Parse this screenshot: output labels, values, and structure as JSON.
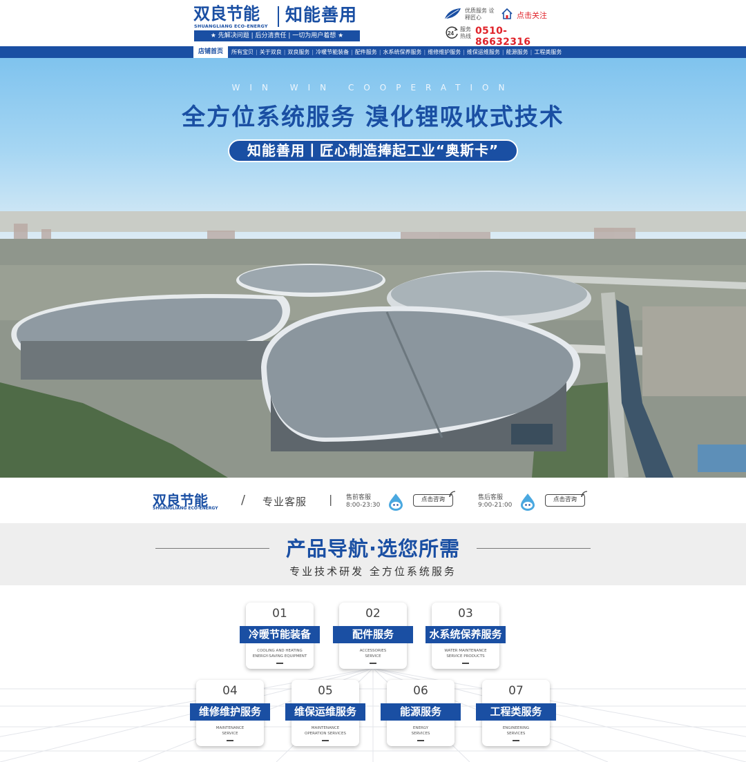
{
  "header": {
    "logo_cn": "双良节能",
    "logo_en": "SHUANGLIANG ECO-ENERGY",
    "logo_slogan": "知能善用",
    "logo_bar": "★ 先解决问题 | 后分清责任 | 一切为用户着想 ★",
    "quality_text": "优质服务 诠释匠心",
    "follow_text": "点击关注",
    "hotline_label": "服务 热线",
    "hotline_number": "0510-86632316"
  },
  "nav": {
    "home": "店铺首页",
    "items": [
      "所有宝贝",
      "关于双良",
      "双良服务",
      "冷暖节能装备",
      "配件服务",
      "水系统保养服务",
      "维修维护服务",
      "维保运维服务",
      "能源服务",
      "工程类服务"
    ]
  },
  "hero": {
    "subtitle_en": "WIN WIN COOPERATION",
    "title": "全方位系统服务  溴化锂吸收式技术",
    "pill": "知能善用丨匠心制造捧起工业“奥斯卡”"
  },
  "service": {
    "logo_cn": "双良节能",
    "logo_en": "SHUANGLIANG ECO-ENERGY",
    "slash": "/",
    "title": "专业客服",
    "bar": "|",
    "presale": {
      "name": "售前客服",
      "hours": "8:00-23:30",
      "button": "点击咨询"
    },
    "aftersale": {
      "name": "售后客服",
      "hours": "9:00-21:00",
      "button": "点击咨询"
    }
  },
  "product_nav": {
    "title": "产品导航·选您所需",
    "subtitle": "专业技术研发  全方位系统服务"
  },
  "cards": [
    {
      "num": "01",
      "label": "冷暖节能装备",
      "en1": "COOLING AND HEATING",
      "en2": "ENERGY-SAVING EQUIPMENT"
    },
    {
      "num": "02",
      "label": "配件服务",
      "en1": "ACCESSORIES",
      "en2": "SERVICE"
    },
    {
      "num": "03",
      "label": "水系统保养服务",
      "en1": "WATER MAINTENANCE",
      "en2": "SERVICE PRODUCTS"
    },
    {
      "num": "04",
      "label": "维修维护服务",
      "en1": "MAINTENANCE",
      "en2": "SERVICE"
    },
    {
      "num": "05",
      "label": "维保运维服务",
      "en1": "MAINTENANCE",
      "en2": "OPERATION SERVICES"
    },
    {
      "num": "06",
      "label": "能源服务",
      "en1": "ENERGY",
      "en2": "SERVICES"
    },
    {
      "num": "07",
      "label": "工程类服务",
      "en1": "ENGINEERING",
      "en2": "SERVICES"
    }
  ],
  "colors": {
    "brand_blue": "#1a4fa3",
    "accent_red": "#e0232a"
  }
}
